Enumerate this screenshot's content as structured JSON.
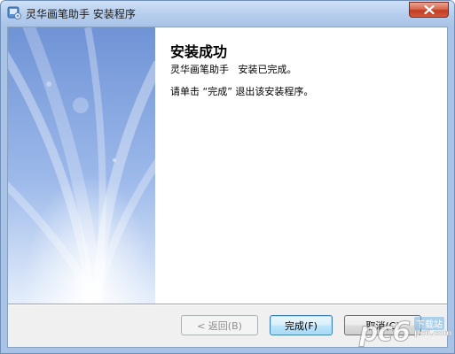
{
  "window": {
    "title": "灵华画笔助手 安装程序",
    "app_icon": "installer-icon",
    "close_icon": "close-icon"
  },
  "content": {
    "heading": "安装成功",
    "line1": "灵华画笔助手   安装已完成。",
    "line2": "请单击 “完成” 退出该安装程序。"
  },
  "buttons": {
    "back": "< 返回(B)",
    "finish": "完成(F)",
    "cancel": "取消(C)"
  },
  "watermark": {
    "logo": "pc6",
    "sub": "下载站",
    "url": "pc6.com"
  },
  "colors": {
    "titlebar": "#b8cfee",
    "close_button": "#c23b22",
    "side_panel_top": "#7c9bd8",
    "side_panel_bottom": "#cfe0f8"
  }
}
